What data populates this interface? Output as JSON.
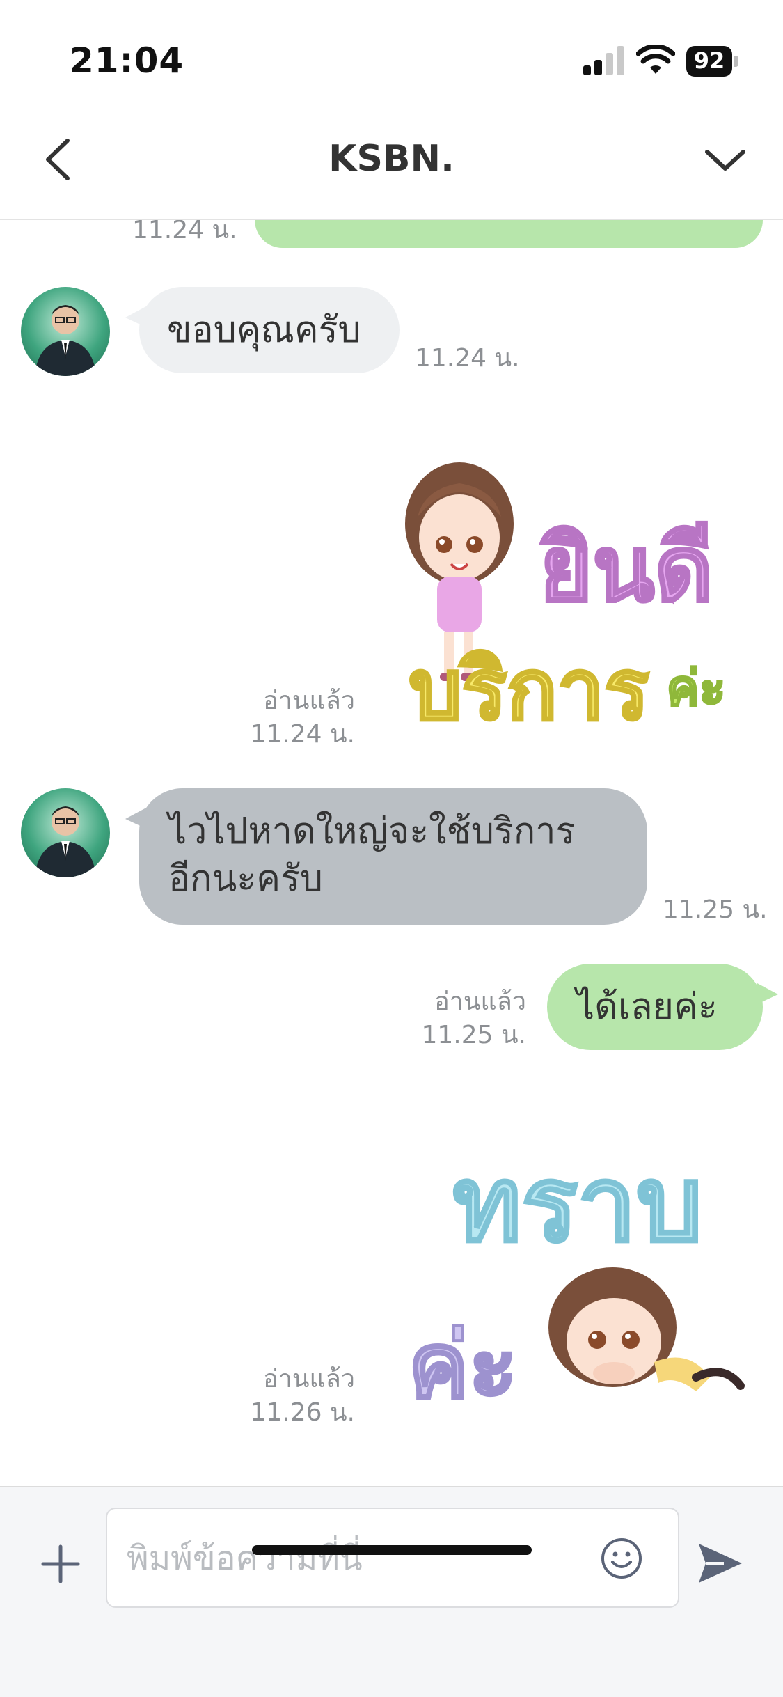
{
  "status_bar": {
    "time": "21:04",
    "battery": "92"
  },
  "header": {
    "title": "KSBN."
  },
  "messages": {
    "partial_top_time": "11.24 น.",
    "m1": {
      "text": "ขอบคุณครับ",
      "time": "11.24 น."
    },
    "m2": {
      "sticker_line1": "ยินดี",
      "sticker_line2": "บริการ",
      "sticker_suffix": "ค่ะ",
      "read": "อ่านแล้ว",
      "time": "11.24 น."
    },
    "m3": {
      "line1": "ไวไปหาดใหญ่จะใช้บริการ",
      "line2": "อีกนะครับ",
      "time": "11.25 น."
    },
    "m4": {
      "text": "ได้เลยค่ะ",
      "read": "อ่านแล้ว",
      "time": "11.25 น."
    },
    "m5": {
      "sticker_line1": "ทราบ",
      "sticker_line2": "ค่ะ",
      "read": "อ่านแล้ว",
      "time": "11.26 น."
    }
  },
  "input": {
    "placeholder": "พิมพ์ข้อความที่นี่"
  },
  "colors": {
    "outgoing_bubble": "#b7e6ab",
    "incoming_bubble": "#eef0f2",
    "incoming_highlight": "#babfc4",
    "accent": "#5b6478"
  },
  "icons": [
    "back-icon",
    "chevron-down-icon",
    "plus-icon",
    "emoji-icon",
    "send-icon",
    "signal-icon",
    "wifi-icon",
    "battery-icon"
  ]
}
